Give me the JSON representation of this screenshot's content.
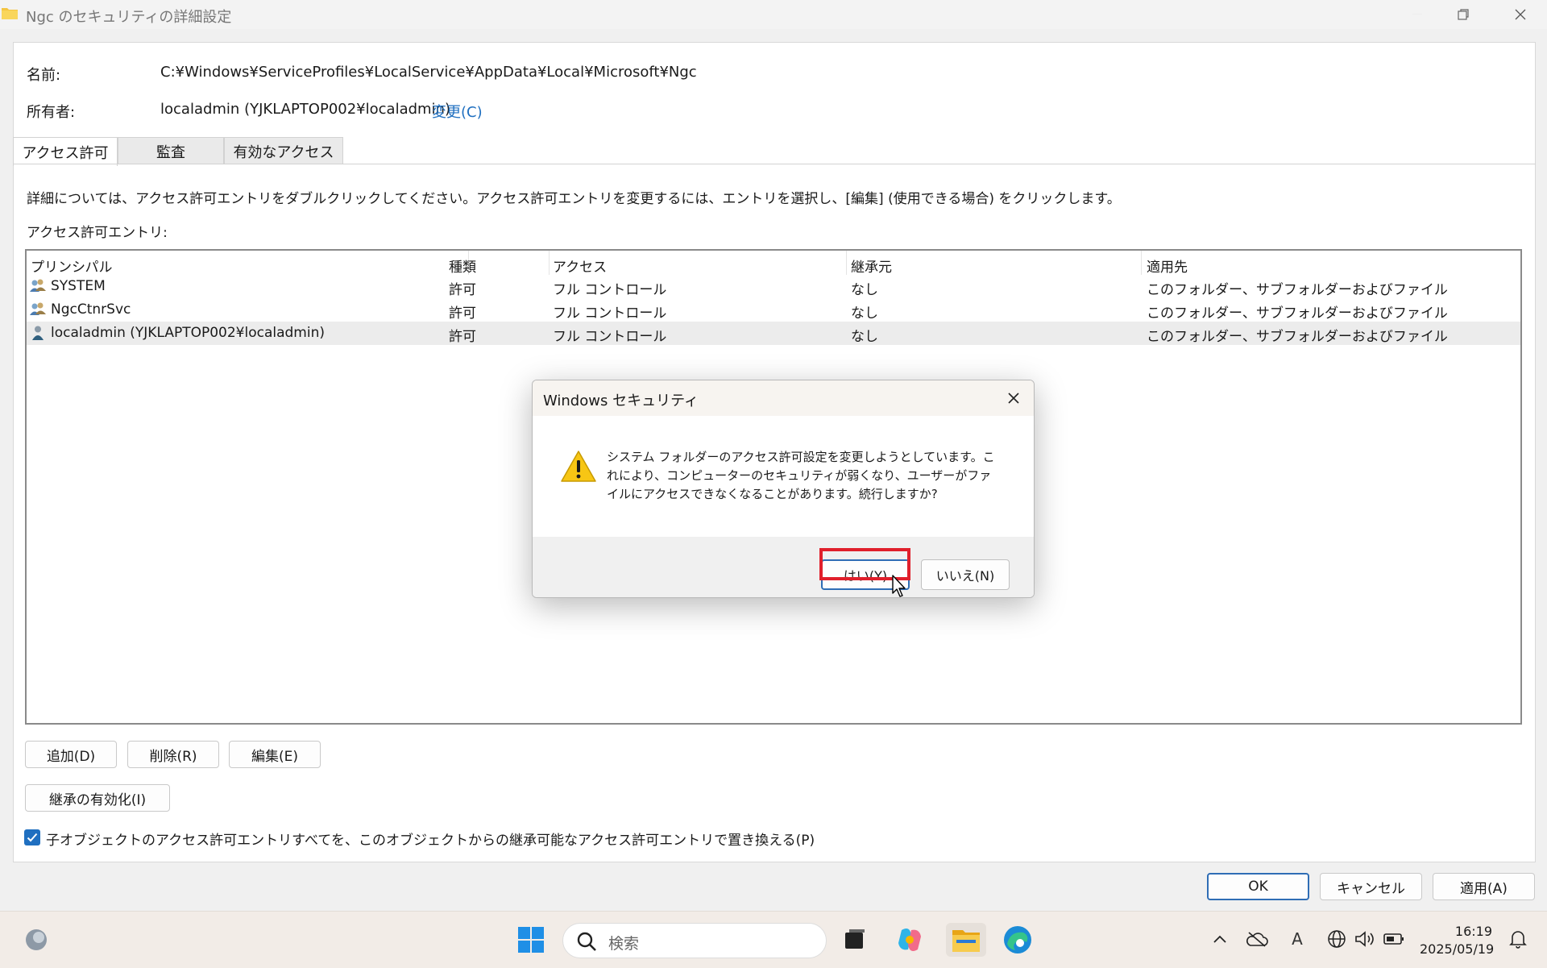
{
  "window": {
    "title": "Ngc のセキュリティの詳細設定",
    "icon": "folder-icon"
  },
  "info": {
    "name_label": "名前:",
    "name_value": "C:¥Windows¥ServiceProfiles¥LocalService¥AppData¥Local¥Microsoft¥Ngc",
    "owner_label": "所有者:",
    "owner_value": "localadmin (YJKLAPTOP002¥localadmin)",
    "change_link": "変更(C)"
  },
  "tabs": [
    {
      "label": "アクセス許可",
      "active": true
    },
    {
      "label": "監査",
      "active": false
    },
    {
      "label": "有効なアクセス",
      "active": false
    }
  ],
  "instructions": "詳細については、アクセス許可エントリをダブルクリックしてください。アクセス許可エントリを変更するには、エントリを選択し、[編集] (使用できる場合) をクリックします。",
  "entries_label": "アクセス許可エントリ:",
  "table": {
    "columns": [
      "プリンシパル",
      "種類",
      "アクセス",
      "継承元",
      "適用先"
    ],
    "rows": [
      {
        "principal": "SYSTEM",
        "type": "許可",
        "access": "フル コントロール",
        "inherited": "なし",
        "applies": "このフォルダー、サブフォルダーおよびファイル",
        "icon": "group-icon"
      },
      {
        "principal": "NgcCtnrSvc",
        "type": "許可",
        "access": "フル コントロール",
        "inherited": "なし",
        "applies": "このフォルダー、サブフォルダーおよびファイル",
        "icon": "group-icon"
      },
      {
        "principal": "localadmin (YJKLAPTOP002¥localadmin)",
        "type": "許可",
        "access": "フル コントロール",
        "inherited": "なし",
        "applies": "このフォルダー、サブフォルダーおよびファイル",
        "icon": "user-icon",
        "selected": true
      }
    ]
  },
  "buttons": {
    "add": "追加(D)",
    "remove": "削除(R)",
    "edit": "編集(E)",
    "enable_inheritance": "継承の有効化(I)",
    "ok": "OK",
    "cancel": "キャンセル",
    "apply": "適用(A)"
  },
  "replace_checkbox": {
    "label": "子オブジェクトのアクセス許可エントリすべてを、このオブジェクトからの継承可能なアクセス許可エントリで置き換える(P)",
    "checked": true
  },
  "dialog": {
    "title": "Windows セキュリティ",
    "message": "システム フォルダーのアクセス許可設定を変更しようとしています。これにより、コンピューターのセキュリティが弱くなり、ユーザーがファイルにアクセスできなくなることがあります。続行しますか?",
    "yes": "はい(Y)",
    "no": "いいえ(N)",
    "highlight_color": "#e01f2b"
  },
  "taskbar": {
    "search_placeholder": "検索",
    "time": "16:19",
    "date": "2025/05/19",
    "ime_indicator": "A",
    "icons": [
      "weather-icon",
      "start-icon",
      "search-icon",
      "task-view-icon",
      "copilot-icon",
      "file-explorer-icon",
      "edge-icon"
    ]
  },
  "colors": {
    "accent": "#1f6fc0",
    "link": "#1f6fc0",
    "taskbar": "#f2ece7"
  }
}
